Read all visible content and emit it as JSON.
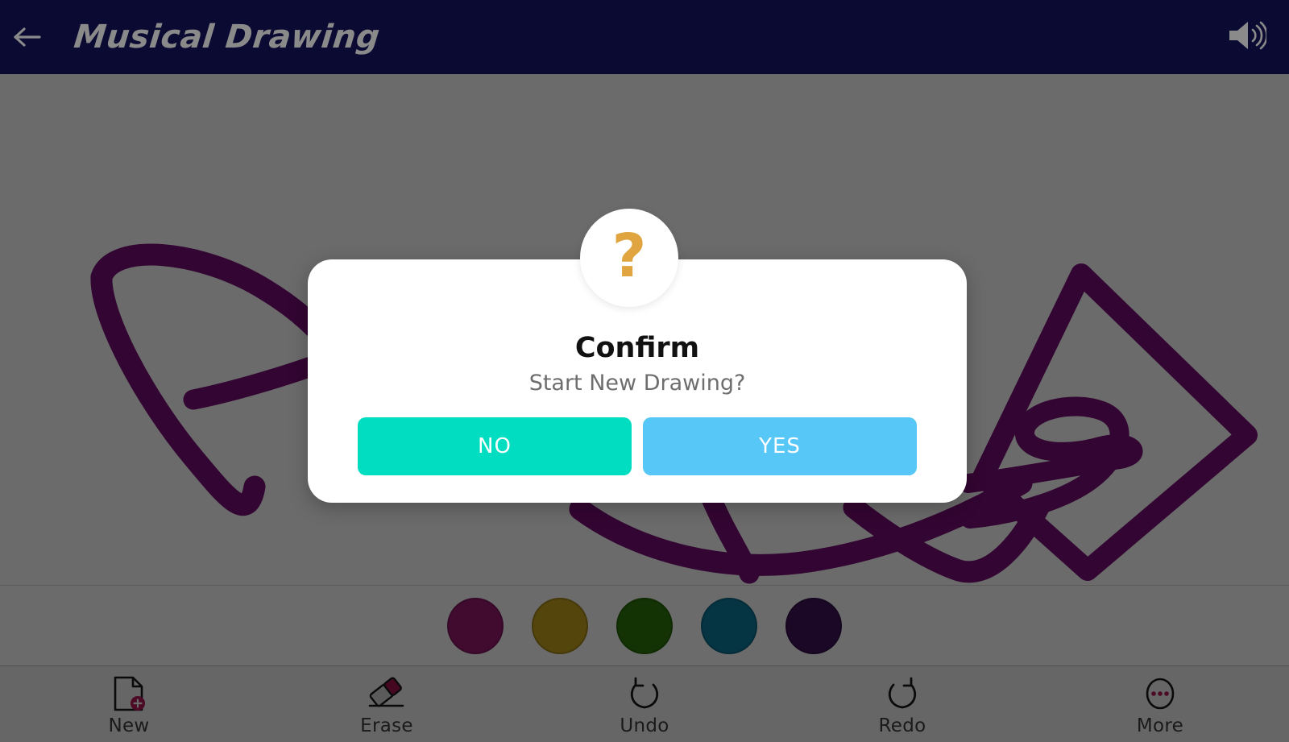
{
  "header": {
    "title": "Musical Drawing",
    "back_icon": "back-arrow-icon",
    "sound_icon": "speaker-volume-icon"
  },
  "dialog": {
    "badge_icon": "question-mark-icon",
    "badge_glyph": "?",
    "title": "Confirm",
    "message": "Start New Drawing?",
    "buttons": [
      {
        "label": "NO",
        "color": "#00ddc0",
        "name": "no-button"
      },
      {
        "label": "YES",
        "color": "#56c7f7",
        "name": "yes-button"
      }
    ]
  },
  "palette": {
    "swatches": [
      {
        "name": "color-swatch-magenta",
        "color": "#9b1b73"
      },
      {
        "name": "color-swatch-gold",
        "color": "#c8a41f"
      },
      {
        "name": "color-swatch-green",
        "color": "#2f7a0a"
      },
      {
        "name": "color-swatch-teal",
        "color": "#0e7fa0"
      },
      {
        "name": "color-swatch-purple",
        "color": "#40145c"
      }
    ]
  },
  "toolbar": {
    "items": [
      {
        "label": "New",
        "icon": "new-document-icon",
        "name": "tool-new"
      },
      {
        "label": "Erase",
        "icon": "eraser-icon",
        "name": "tool-erase"
      },
      {
        "label": "Undo",
        "icon": "undo-arrow-icon",
        "name": "tool-undo"
      },
      {
        "label": "Redo",
        "icon": "redo-arrow-icon",
        "name": "tool-redo"
      },
      {
        "label": "More",
        "icon": "more-dots-icon",
        "name": "tool-more"
      }
    ]
  },
  "canvas": {
    "stroke_color": "#7b0e78",
    "stroke_width": 26,
    "background": "#ffffff"
  },
  "colors": {
    "header_bg": "#0a0a33",
    "header_fg": "#8a8a8a",
    "accent_crimson": "#b5195a",
    "question_gold": "#e0a540",
    "overlay": "rgba(0,0,0,0.58)"
  }
}
